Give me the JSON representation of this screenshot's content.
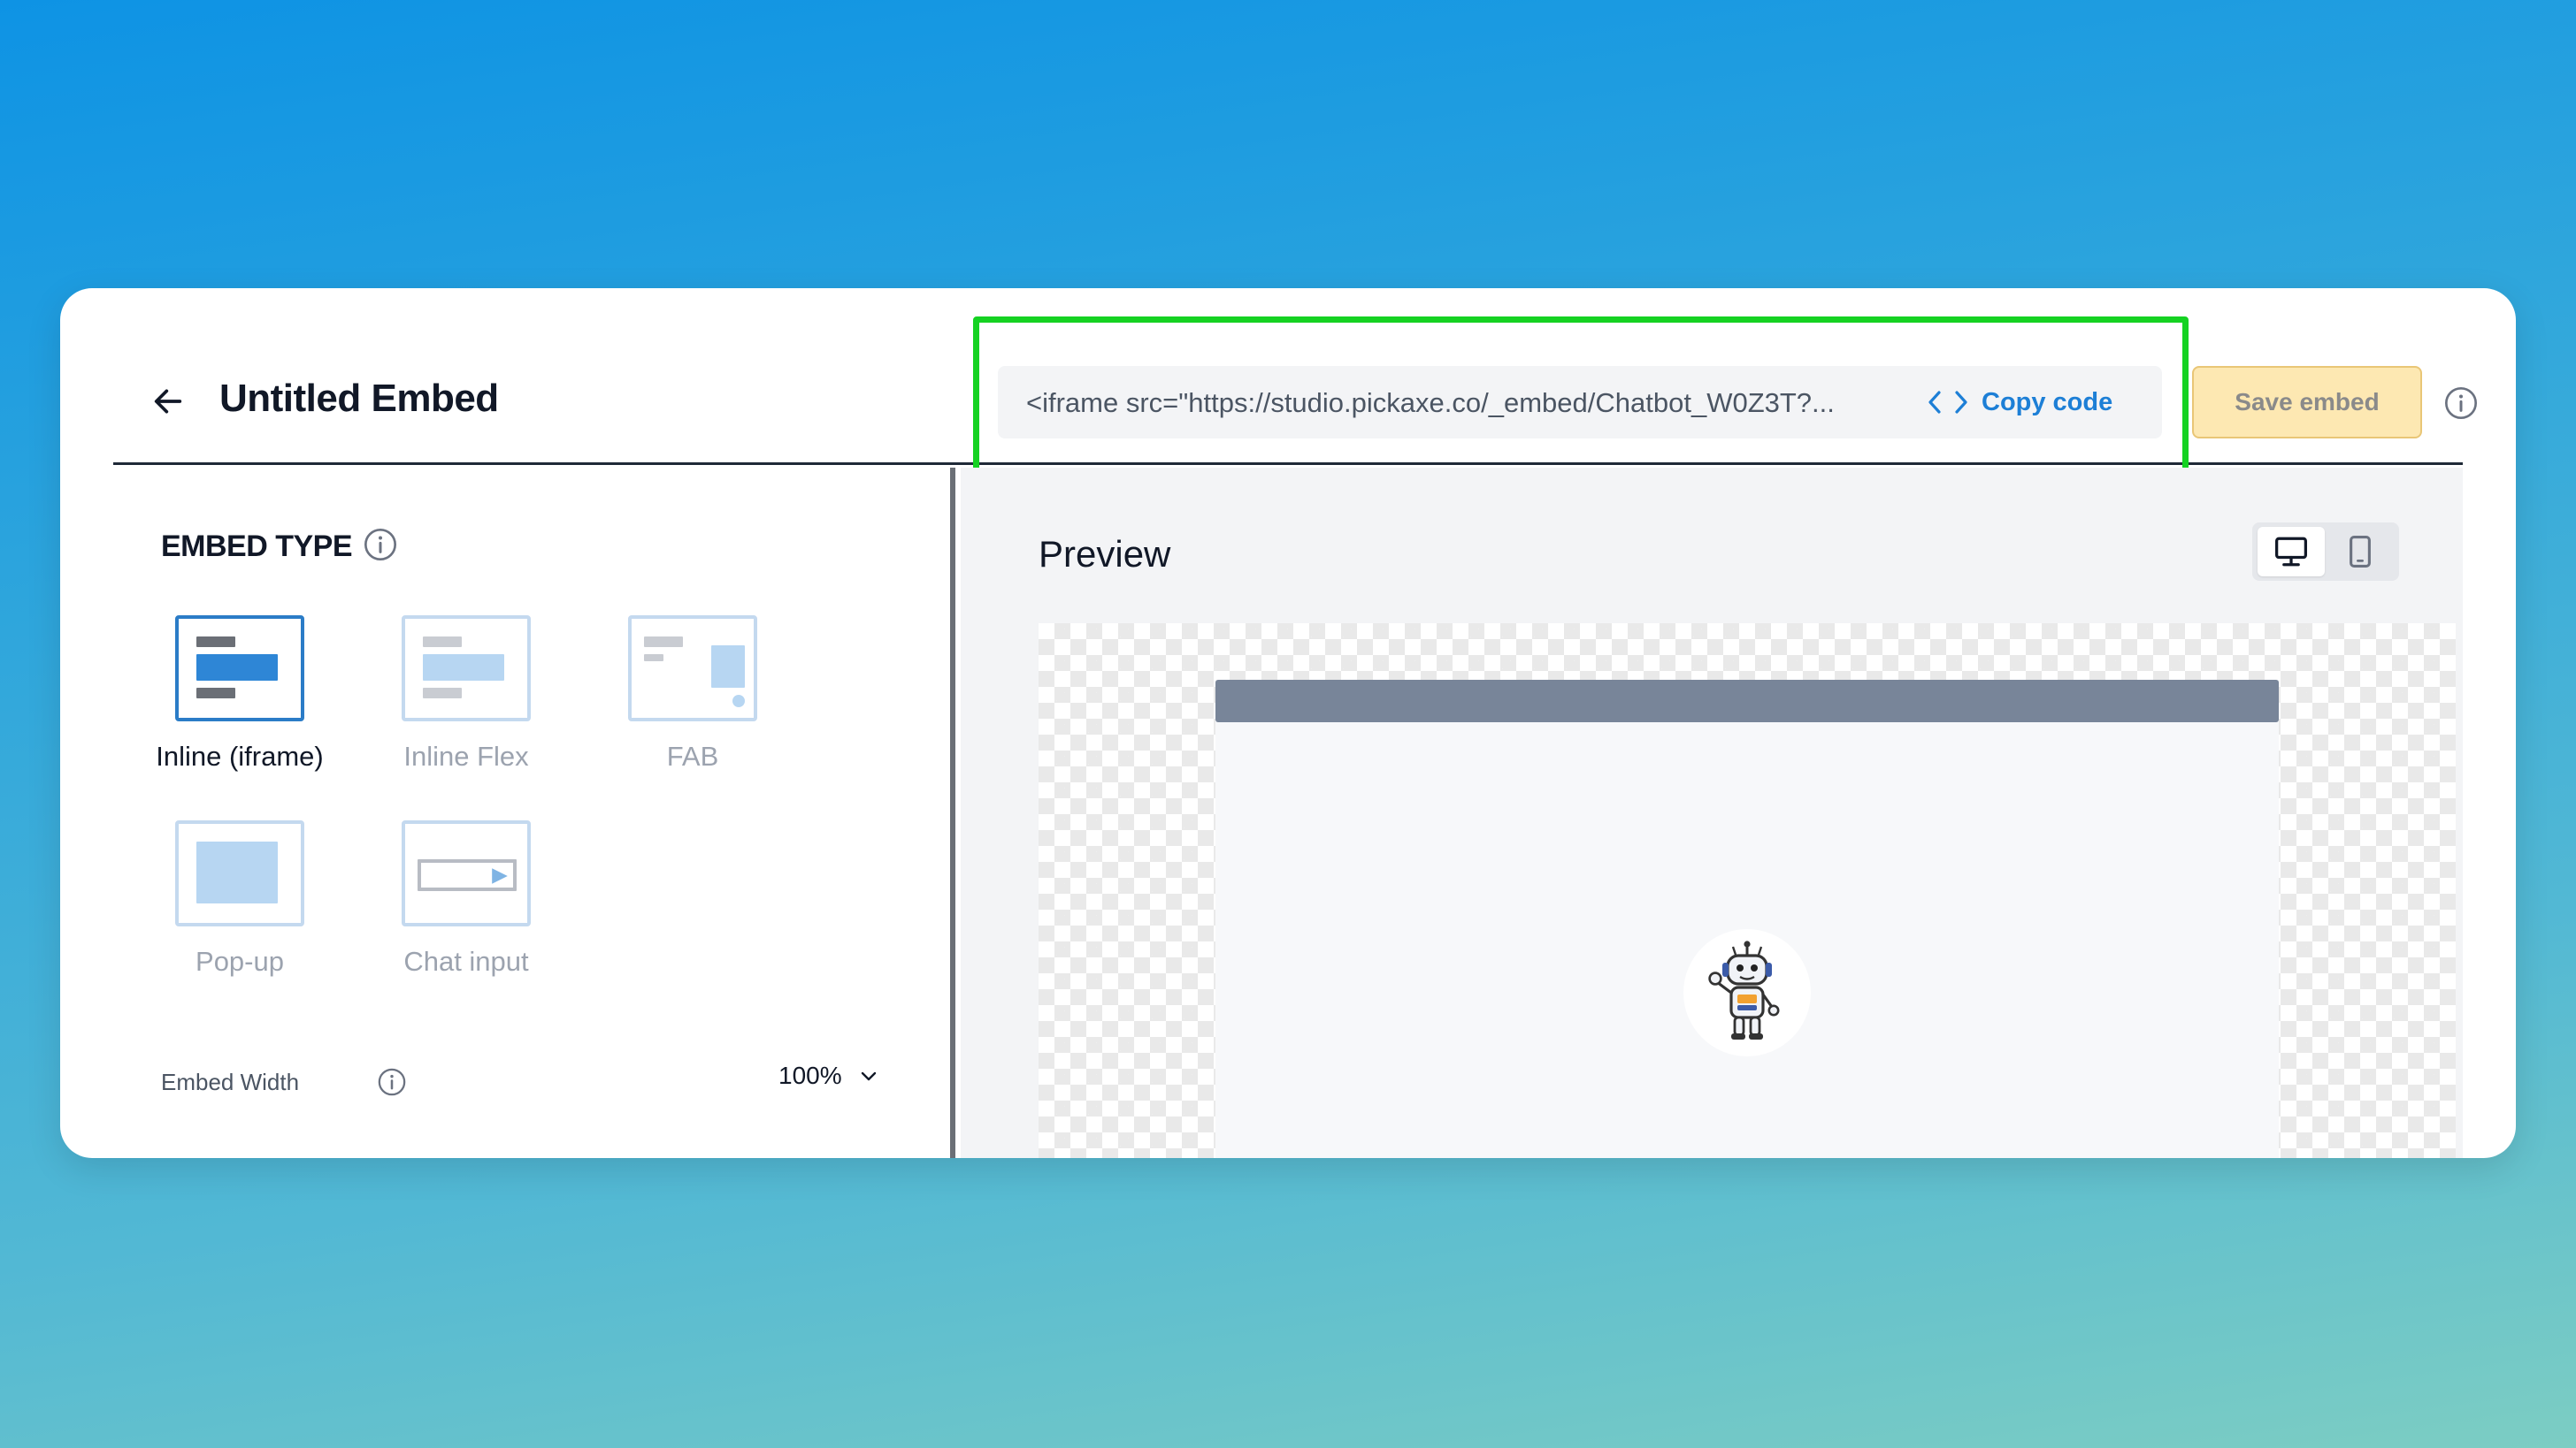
{
  "header": {
    "title": "Untitled Embed",
    "embed_code": "<iframe src=\"https://studio.pickaxe.co/_embed/Chatbot_W0Z3T?...",
    "copy_label": "Copy code",
    "save_label": "Save embed"
  },
  "sidebar": {
    "section_title": "EMBED TYPE",
    "embed_types": [
      {
        "label": "Inline (iframe)",
        "selected": true
      },
      {
        "label": "Inline Flex",
        "selected": false
      },
      {
        "label": "FAB",
        "selected": false
      },
      {
        "label": "Pop-up",
        "selected": false
      },
      {
        "label": "Chat input",
        "selected": false
      }
    ],
    "width_label": "Embed Width",
    "width_value": "100%"
  },
  "preview": {
    "title": "Preview",
    "active_device": "desktop"
  },
  "colors": {
    "accent": "#1d7fd6",
    "highlight": "#15d222",
    "save_bg": "#fde8b2"
  }
}
